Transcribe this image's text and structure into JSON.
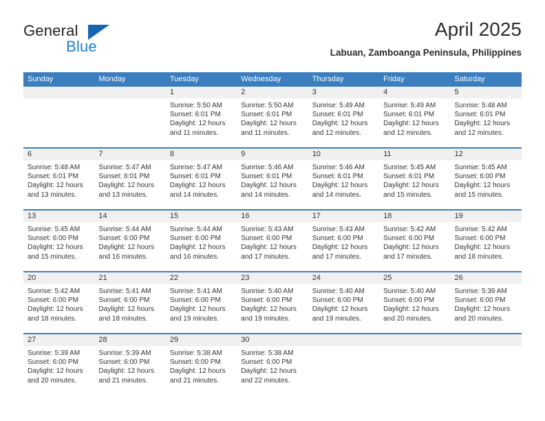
{
  "brand": {
    "name_part1": "General",
    "name_part2": "Blue",
    "triangle_color": "#1565b0",
    "blue_color": "#1b7fd4"
  },
  "header": {
    "month_title": "April 2025",
    "location": "Labuan, Zamboanga Peninsula, Philippines"
  },
  "colors": {
    "header_band": "#3a7ebf",
    "daynum_band": "#f0f0f0",
    "text": "#333333"
  },
  "weekdays": [
    "Sunday",
    "Monday",
    "Tuesday",
    "Wednesday",
    "Thursday",
    "Friday",
    "Saturday"
  ],
  "weeks": [
    [
      {
        "day": "",
        "sunrise": "",
        "sunset": "",
        "daylight1": "",
        "daylight2": ""
      },
      {
        "day": "",
        "sunrise": "",
        "sunset": "",
        "daylight1": "",
        "daylight2": ""
      },
      {
        "day": "1",
        "sunrise": "Sunrise: 5:50 AM",
        "sunset": "Sunset: 6:01 PM",
        "daylight1": "Daylight: 12 hours",
        "daylight2": "and 11 minutes."
      },
      {
        "day": "2",
        "sunrise": "Sunrise: 5:50 AM",
        "sunset": "Sunset: 6:01 PM",
        "daylight1": "Daylight: 12 hours",
        "daylight2": "and 11 minutes."
      },
      {
        "day": "3",
        "sunrise": "Sunrise: 5:49 AM",
        "sunset": "Sunset: 6:01 PM",
        "daylight1": "Daylight: 12 hours",
        "daylight2": "and 12 minutes."
      },
      {
        "day": "4",
        "sunrise": "Sunrise: 5:49 AM",
        "sunset": "Sunset: 6:01 PM",
        "daylight1": "Daylight: 12 hours",
        "daylight2": "and 12 minutes."
      },
      {
        "day": "5",
        "sunrise": "Sunrise: 5:48 AM",
        "sunset": "Sunset: 6:01 PM",
        "daylight1": "Daylight: 12 hours",
        "daylight2": "and 12 minutes."
      }
    ],
    [
      {
        "day": "6",
        "sunrise": "Sunrise: 5:48 AM",
        "sunset": "Sunset: 6:01 PM",
        "daylight1": "Daylight: 12 hours",
        "daylight2": "and 13 minutes."
      },
      {
        "day": "7",
        "sunrise": "Sunrise: 5:47 AM",
        "sunset": "Sunset: 6:01 PM",
        "daylight1": "Daylight: 12 hours",
        "daylight2": "and 13 minutes."
      },
      {
        "day": "8",
        "sunrise": "Sunrise: 5:47 AM",
        "sunset": "Sunset: 6:01 PM",
        "daylight1": "Daylight: 12 hours",
        "daylight2": "and 14 minutes."
      },
      {
        "day": "9",
        "sunrise": "Sunrise: 5:46 AM",
        "sunset": "Sunset: 6:01 PM",
        "daylight1": "Daylight: 12 hours",
        "daylight2": "and 14 minutes."
      },
      {
        "day": "10",
        "sunrise": "Sunrise: 5:46 AM",
        "sunset": "Sunset: 6:01 PM",
        "daylight1": "Daylight: 12 hours",
        "daylight2": "and 14 minutes."
      },
      {
        "day": "11",
        "sunrise": "Sunrise: 5:45 AM",
        "sunset": "Sunset: 6:01 PM",
        "daylight1": "Daylight: 12 hours",
        "daylight2": "and 15 minutes."
      },
      {
        "day": "12",
        "sunrise": "Sunrise: 5:45 AM",
        "sunset": "Sunset: 6:00 PM",
        "daylight1": "Daylight: 12 hours",
        "daylight2": "and 15 minutes."
      }
    ],
    [
      {
        "day": "13",
        "sunrise": "Sunrise: 5:45 AM",
        "sunset": "Sunset: 6:00 PM",
        "daylight1": "Daylight: 12 hours",
        "daylight2": "and 15 minutes."
      },
      {
        "day": "14",
        "sunrise": "Sunrise: 5:44 AM",
        "sunset": "Sunset: 6:00 PM",
        "daylight1": "Daylight: 12 hours",
        "daylight2": "and 16 minutes."
      },
      {
        "day": "15",
        "sunrise": "Sunrise: 5:44 AM",
        "sunset": "Sunset: 6:00 PM",
        "daylight1": "Daylight: 12 hours",
        "daylight2": "and 16 minutes."
      },
      {
        "day": "16",
        "sunrise": "Sunrise: 5:43 AM",
        "sunset": "Sunset: 6:00 PM",
        "daylight1": "Daylight: 12 hours",
        "daylight2": "and 17 minutes."
      },
      {
        "day": "17",
        "sunrise": "Sunrise: 5:43 AM",
        "sunset": "Sunset: 6:00 PM",
        "daylight1": "Daylight: 12 hours",
        "daylight2": "and 17 minutes."
      },
      {
        "day": "18",
        "sunrise": "Sunrise: 5:42 AM",
        "sunset": "Sunset: 6:00 PM",
        "daylight1": "Daylight: 12 hours",
        "daylight2": "and 17 minutes."
      },
      {
        "day": "19",
        "sunrise": "Sunrise: 5:42 AM",
        "sunset": "Sunset: 6:00 PM",
        "daylight1": "Daylight: 12 hours",
        "daylight2": "and 18 minutes."
      }
    ],
    [
      {
        "day": "20",
        "sunrise": "Sunrise: 5:42 AM",
        "sunset": "Sunset: 6:00 PM",
        "daylight1": "Daylight: 12 hours",
        "daylight2": "and 18 minutes."
      },
      {
        "day": "21",
        "sunrise": "Sunrise: 5:41 AM",
        "sunset": "Sunset: 6:00 PM",
        "daylight1": "Daylight: 12 hours",
        "daylight2": "and 18 minutes."
      },
      {
        "day": "22",
        "sunrise": "Sunrise: 5:41 AM",
        "sunset": "Sunset: 6:00 PM",
        "daylight1": "Daylight: 12 hours",
        "daylight2": "and 19 minutes."
      },
      {
        "day": "23",
        "sunrise": "Sunrise: 5:40 AM",
        "sunset": "Sunset: 6:00 PM",
        "daylight1": "Daylight: 12 hours",
        "daylight2": "and 19 minutes."
      },
      {
        "day": "24",
        "sunrise": "Sunrise: 5:40 AM",
        "sunset": "Sunset: 6:00 PM",
        "daylight1": "Daylight: 12 hours",
        "daylight2": "and 19 minutes."
      },
      {
        "day": "25",
        "sunrise": "Sunrise: 5:40 AM",
        "sunset": "Sunset: 6:00 PM",
        "daylight1": "Daylight: 12 hours",
        "daylight2": "and 20 minutes."
      },
      {
        "day": "26",
        "sunrise": "Sunrise: 5:39 AM",
        "sunset": "Sunset: 6:00 PM",
        "daylight1": "Daylight: 12 hours",
        "daylight2": "and 20 minutes."
      }
    ],
    [
      {
        "day": "27",
        "sunrise": "Sunrise: 5:39 AM",
        "sunset": "Sunset: 6:00 PM",
        "daylight1": "Daylight: 12 hours",
        "daylight2": "and 20 minutes."
      },
      {
        "day": "28",
        "sunrise": "Sunrise: 5:39 AM",
        "sunset": "Sunset: 6:00 PM",
        "daylight1": "Daylight: 12 hours",
        "daylight2": "and 21 minutes."
      },
      {
        "day": "29",
        "sunrise": "Sunrise: 5:38 AM",
        "sunset": "Sunset: 6:00 PM",
        "daylight1": "Daylight: 12 hours",
        "daylight2": "and 21 minutes."
      },
      {
        "day": "30",
        "sunrise": "Sunrise: 5:38 AM",
        "sunset": "Sunset: 6:00 PM",
        "daylight1": "Daylight: 12 hours",
        "daylight2": "and 22 minutes."
      },
      {
        "day": "",
        "sunrise": "",
        "sunset": "",
        "daylight1": "",
        "daylight2": ""
      },
      {
        "day": "",
        "sunrise": "",
        "sunset": "",
        "daylight1": "",
        "daylight2": ""
      },
      {
        "day": "",
        "sunrise": "",
        "sunset": "",
        "daylight1": "",
        "daylight2": ""
      }
    ]
  ]
}
